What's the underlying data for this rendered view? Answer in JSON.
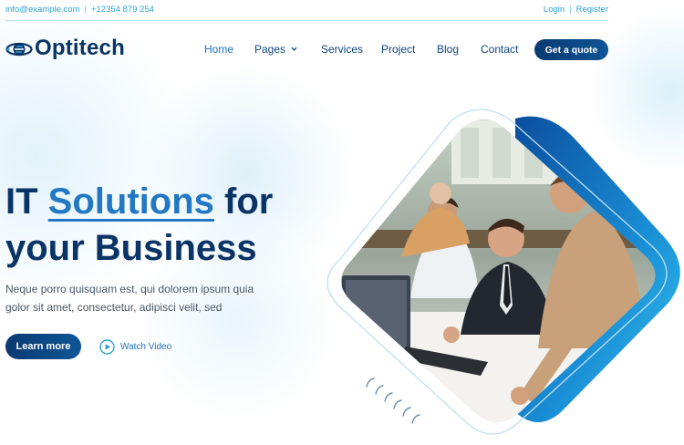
{
  "topbar": {
    "email": "info@example.com",
    "separator": "|",
    "phone": "+12354 879 254",
    "login": "Login",
    "register": "Register"
  },
  "brand": {
    "name": "Optitech",
    "logo_icon": "orbit-logo-icon"
  },
  "nav": {
    "items": [
      {
        "label": "Home",
        "active": true
      },
      {
        "label": "Pages",
        "dropdown": true
      },
      {
        "label": "Services"
      },
      {
        "label": "Project"
      },
      {
        "label": "Blog"
      },
      {
        "label": "Contact"
      }
    ],
    "cta": "Get a quote"
  },
  "hero": {
    "title_word1": "IT",
    "title_highlight": "Solutions",
    "title_word3": "for",
    "title_line2": "your Business",
    "description": "Neque porro quisquam est, qui dolorem ipsum quia golor sit amet, consectetur, adipisci velit, sed",
    "primary_button": "Learn more",
    "video_link": "Watch Video",
    "image": "office-team-at-computer-photo"
  },
  "colors": {
    "navy": "#0a3366",
    "accent": "#2278c4",
    "link": "#2ea2d6",
    "button_gradient_start": "#0a3a72",
    "button_gradient_end": "#0f5596"
  }
}
